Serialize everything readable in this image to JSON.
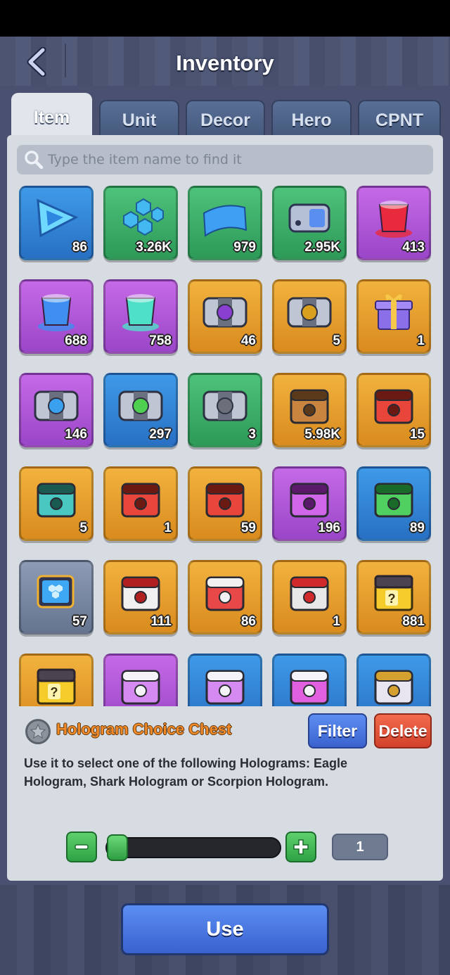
{
  "header": {
    "title": "Inventory",
    "back_icon": "back-arrow-icon"
  },
  "tabs": [
    {
      "label": "Item",
      "active": true
    },
    {
      "label": "Unit",
      "active": false
    },
    {
      "label": "Decor",
      "active": false
    },
    {
      "label": "Hero",
      "active": false
    },
    {
      "label": "CPNT",
      "active": false
    }
  ],
  "search": {
    "placeholder": "Type the item name to find it",
    "value": ""
  },
  "items": [
    {
      "icon": "blue-triangle-shard-icon",
      "rarity": "blue",
      "count": "86"
    },
    {
      "icon": "hex-tiles-icon",
      "rarity": "green",
      "count": "3.26K"
    },
    {
      "icon": "blue-panel-icon",
      "rarity": "green",
      "count": "979"
    },
    {
      "icon": "battery-module-icon",
      "rarity": "green",
      "count": "2.95K"
    },
    {
      "icon": "red-paint-bucket-icon",
      "rarity": "purple",
      "count": "413"
    },
    {
      "icon": "blue-paint-bucket-icon",
      "rarity": "purple",
      "count": "688"
    },
    {
      "icon": "teal-paint-bucket-icon",
      "rarity": "purple",
      "count": "758"
    },
    {
      "icon": "purple-capsule-chest-icon",
      "rarity": "gold",
      "count": "46"
    },
    {
      "icon": "gold-capsule-chest-icon",
      "rarity": "gold",
      "count": "5"
    },
    {
      "icon": "gift-box-icon",
      "rarity": "gold",
      "count": "1"
    },
    {
      "icon": "blue-capsule-chest-icon",
      "rarity": "purple",
      "count": "146"
    },
    {
      "icon": "green-capsule-chest-icon",
      "rarity": "blue",
      "count": "297"
    },
    {
      "icon": "grey-capsule-chest-icon",
      "rarity": "green",
      "count": "3"
    },
    {
      "icon": "bronze-crate-icon",
      "rarity": "gold",
      "count": "5.98K"
    },
    {
      "icon": "red-hero-chest-icon",
      "rarity": "gold",
      "count": "15"
    },
    {
      "icon": "teal-crate-icon",
      "rarity": "gold",
      "count": "5"
    },
    {
      "icon": "red-chest-icon",
      "rarity": "gold",
      "count": "1"
    },
    {
      "icon": "red-chest-icon",
      "rarity": "gold",
      "count": "59"
    },
    {
      "icon": "purple-hero-chest-icon",
      "rarity": "purple",
      "count": "196"
    },
    {
      "icon": "green-hero-chest-icon",
      "rarity": "blue",
      "count": "89"
    },
    {
      "icon": "hologram-device-icon",
      "rarity": "grey",
      "count": "57"
    },
    {
      "icon": "white-red-chest-icon",
      "rarity": "gold",
      "count": "111"
    },
    {
      "icon": "red-white-chest-icon",
      "rarity": "gold",
      "count": "86"
    },
    {
      "icon": "robot-head-chest-icon",
      "rarity": "gold",
      "count": "1"
    },
    {
      "icon": "mystery-chest-icon",
      "rarity": "gold",
      "count": "881"
    },
    {
      "icon": "mystery-chest-icon",
      "rarity": "gold",
      "count": ""
    },
    {
      "icon": "purple-white-chest-icon",
      "rarity": "purple",
      "count": ""
    },
    {
      "icon": "purple-white-chest-icon",
      "rarity": "blue",
      "count": ""
    },
    {
      "icon": "pink-white-chest-icon",
      "rarity": "blue",
      "count": ""
    },
    {
      "icon": "white-gold-chest-icon",
      "rarity": "blue",
      "count": ""
    }
  ],
  "detail": {
    "name": "Hologram Choice Chest",
    "description": "Use it to select one of the following Holograms: Eagle Hologram, Shark Hologram or Scorpion Hologram.",
    "filter_label": "Filter",
    "delete_label": "Delete"
  },
  "quantity": {
    "value": "1",
    "min": 1,
    "max": 881,
    "level": 0.0
  },
  "use_label": "Use",
  "colors": {
    "blue": "#3f9ae8",
    "green": "#4ec27a",
    "purple": "#c56ae6",
    "gold": "#f2b23e",
    "grey": "#8d9bb6",
    "name": "#f28a2a",
    "filter": "#5d8ef0",
    "delete": "#f26a4c",
    "stepper": "#5fd06c"
  }
}
